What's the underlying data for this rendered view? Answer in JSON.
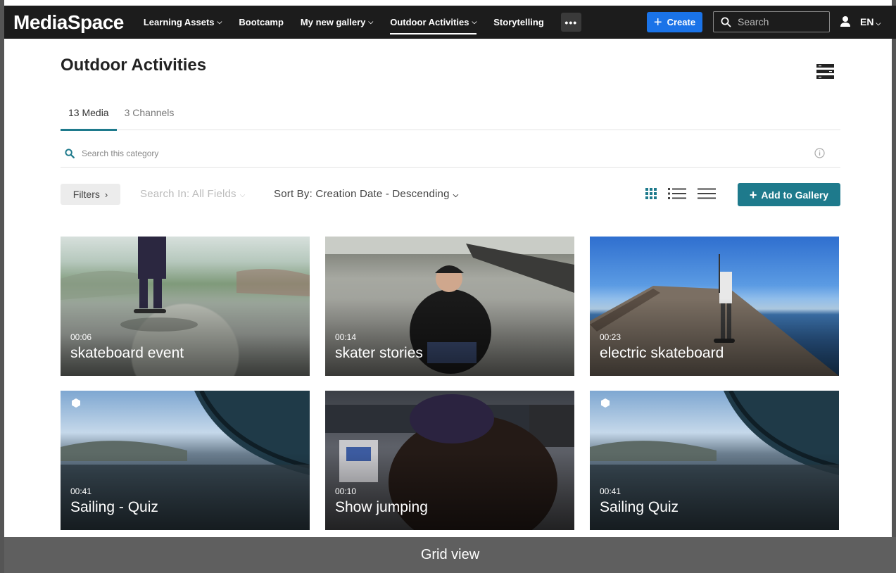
{
  "header": {
    "brand": "MediaSpace",
    "nav": [
      {
        "label": "Learning Assets",
        "dropdown": true
      },
      {
        "label": "Bootcamp",
        "dropdown": false
      },
      {
        "label": "My new gallery",
        "dropdown": true
      },
      {
        "label": "Outdoor Activities",
        "dropdown": true,
        "active": true
      },
      {
        "label": "Storytelling",
        "dropdown": false
      }
    ],
    "more_label": "•••",
    "create_label": "Create",
    "search_placeholder": "Search",
    "language": "EN"
  },
  "page": {
    "title": "Outdoor Activities",
    "tabs": [
      {
        "label": "13 Media",
        "active": true
      },
      {
        "label": "3 Channels",
        "active": false
      }
    ],
    "category_search_placeholder": "Search this category",
    "filters_label": "Filters",
    "search_in_label": "Search In: All Fields",
    "sort_by_label": "Sort By: Creation Date - Descending",
    "add_to_gallery_label": "Add to Gallery"
  },
  "media": [
    {
      "duration": "00:06",
      "title": "skateboard event",
      "badge": false
    },
    {
      "duration": "00:14",
      "title": "skater stories",
      "badge": false
    },
    {
      "duration": "00:23",
      "title": "electric skateboard",
      "badge": false
    },
    {
      "duration": "00:41",
      "title": "Sailing - Quiz",
      "badge": true
    },
    {
      "duration": "00:10",
      "title": "Show jumping",
      "badge": false
    },
    {
      "duration": "00:41",
      "title": "Sailing Quiz",
      "badge": true
    }
  ],
  "caption": "Grid view",
  "colors": {
    "accent": "#1e7a8c",
    "create_button": "#1a73e8",
    "topbar": "#1c1c1c"
  }
}
